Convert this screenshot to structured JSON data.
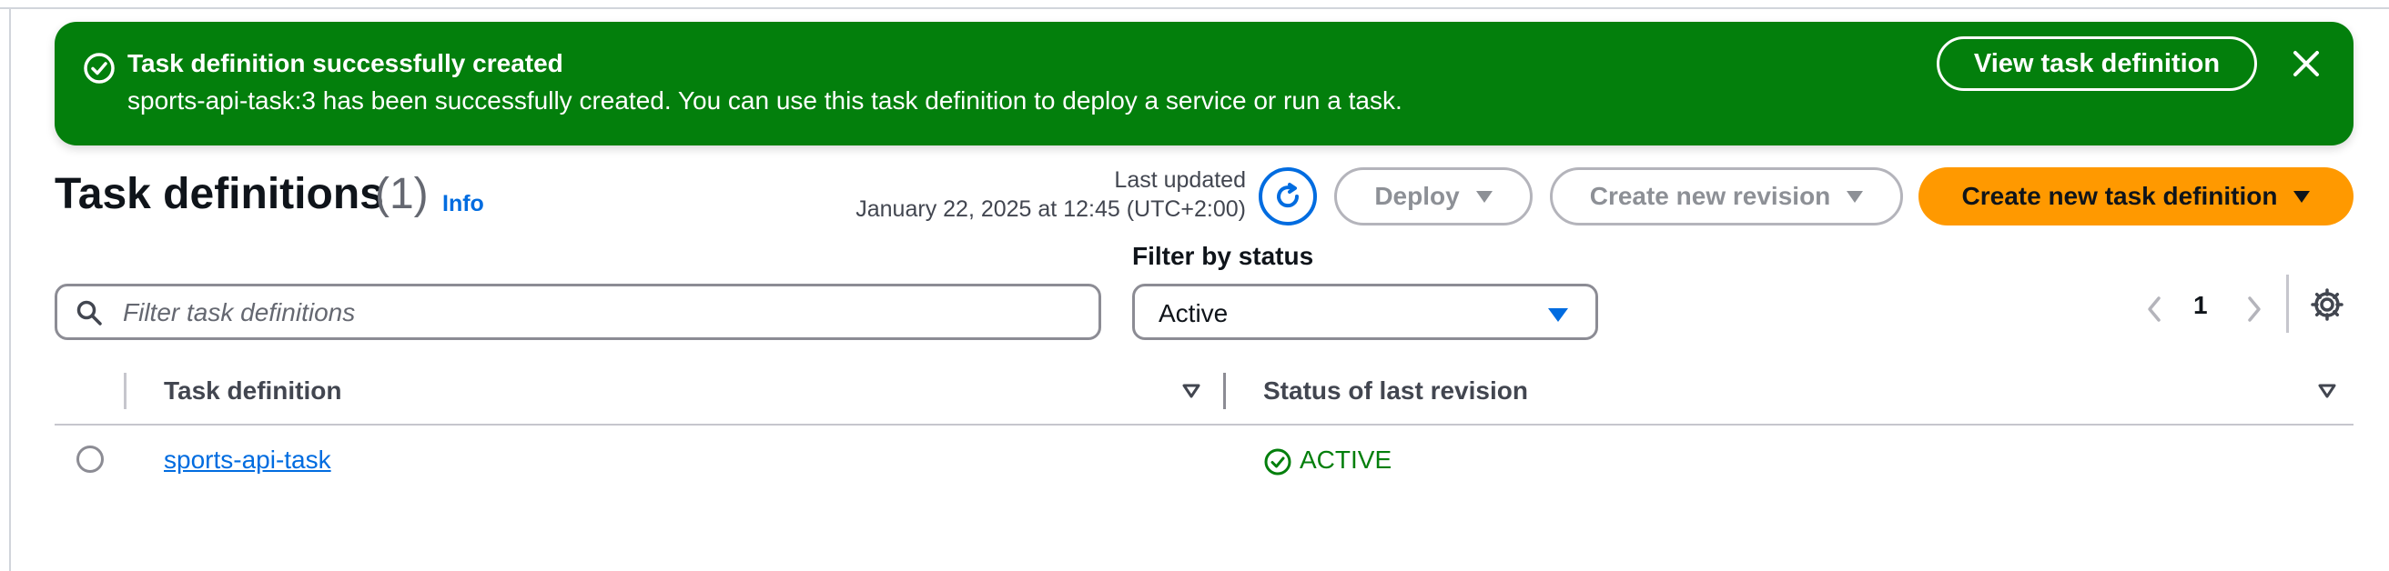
{
  "flash": {
    "title": "Task definition successfully created",
    "message": "sports-api-task:3 has been successfully created. You can use this task definition to deploy a service or run a task.",
    "view_button": "View task definition",
    "icon": "check-circle-icon",
    "close_icon": "close-icon",
    "color": "#037f0c"
  },
  "header": {
    "title": "Task definitions",
    "count": "(1)",
    "info": "Info",
    "last_updated_label": "Last updated",
    "last_updated_value": "January 22, 2025 at 12:45 (UTC+2:00)",
    "refresh_icon": "refresh-icon",
    "deploy_label": "Deploy",
    "create_revision_label": "Create new revision",
    "create_task_label": "Create new task definition",
    "primary_color": "#ff9900"
  },
  "filters": {
    "search_placeholder": "Filter task definitions",
    "status_label": "Filter by status",
    "status_value": "Active"
  },
  "pagination": {
    "current_page": "1"
  },
  "table": {
    "columns": [
      "Task definition",
      "Status of last revision"
    ],
    "rows": [
      {
        "name": "sports-api-task",
        "status": "ACTIVE"
      }
    ],
    "status_color": "#037f0c"
  }
}
